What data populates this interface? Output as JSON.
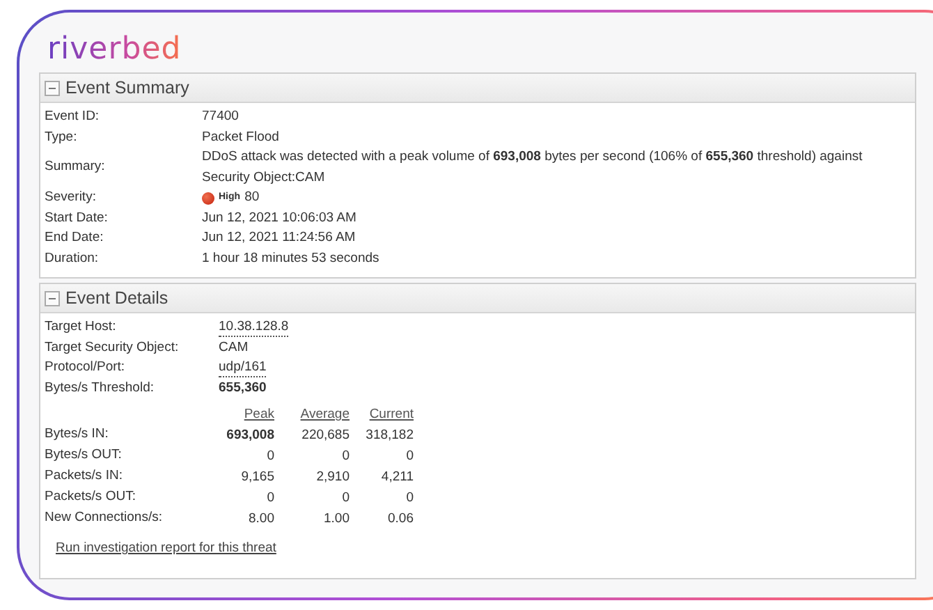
{
  "logo": "riverbed",
  "event_summary": {
    "title": "Event Summary",
    "expanded": true,
    "rows": [
      {
        "label": "Event ID:",
        "value": "77400"
      },
      {
        "label": "Type:",
        "value": "Packet Flood"
      },
      {
        "label": "Summary:",
        "value": "DDoS attack was detected with a peak volume of **693,008** bytes per second (106% of **655,360** threshold) against Security Object:CAM"
      },
      {
        "label": "Severity:",
        "kind": "severity",
        "badge": "High",
        "value": "80"
      },
      {
        "label": "Start Date:",
        "value": "Jun 12, 2021 10:06:03 AM"
      },
      {
        "label": "End Date:",
        "value": "Jun 12, 2021 11:24:56 AM"
      },
      {
        "label": "Duration:",
        "value": "1 hour 18 minutes 53 seconds"
      }
    ]
  },
  "event_details": {
    "title": "Event Details",
    "expanded": true,
    "rows": [
      {
        "label": "Target Host:",
        "value": "10.38.128.8",
        "link": true,
        "bold": false
      },
      {
        "label": "Target Security Object:",
        "value": "CAM",
        "link": false,
        "bold": false
      },
      {
        "label": "Protocol/Port:",
        "value": "udp/161",
        "link": true,
        "bold": false
      },
      {
        "label": "Bytes/s Threshold:",
        "value": "655,360",
        "link": false,
        "bold": true
      }
    ],
    "stats_columns": [
      "Peak",
      "Average",
      "Current"
    ],
    "stats_rows": [
      {
        "label": "Bytes/s IN:",
        "values": [
          "693,008",
          "220,685",
          "318,182"
        ],
        "peak_bold": true
      },
      {
        "label": "Bytes/s OUT:",
        "values": [
          "0",
          "0",
          "0"
        ],
        "peak_bold": false
      },
      {
        "label": "Packets/s IN:",
        "values": [
          "9,165",
          "2,910",
          "4,211"
        ],
        "peak_bold": false
      },
      {
        "label": "Packets/s OUT:",
        "values": [
          "0",
          "0",
          "0"
        ],
        "peak_bold": false
      },
      {
        "label": "New Connections/s:",
        "values": [
          "8.00",
          "1.00",
          "0.06"
        ],
        "peak_bold": false
      }
    ],
    "report_link": "Run investigation report for this threat"
  }
}
